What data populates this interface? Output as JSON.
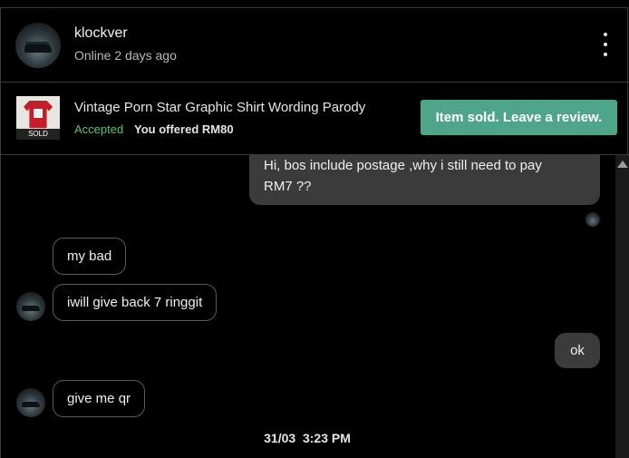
{
  "header": {
    "username": "klockver",
    "status": "Online 2 days ago"
  },
  "product": {
    "title": "Vintage Porn Star Graphic Shirt Wording Parody",
    "badge": "SOLD",
    "offer_status": "Accepted",
    "offer_text": "You offered RM80",
    "action_label": "Item sold. Leave a review."
  },
  "messages": [
    {
      "from": "me",
      "lines": [
        "Hi, bos include postage ,why i still need to pay",
        "RM7 ??"
      ]
    },
    {
      "from": "them",
      "text": "my bad"
    },
    {
      "from": "them",
      "text": "iwill give back 7 ringgit"
    },
    {
      "from": "me",
      "text": "ok"
    },
    {
      "from": "them",
      "text": "give me qr"
    }
  ],
  "timestamp": {
    "date": "31/03",
    "time": "3:23 PM"
  },
  "colors": {
    "accent": "#4fa58a",
    "accepted": "#5fbf86",
    "bubble_out": "#3b3b3b",
    "background": "#000000"
  }
}
